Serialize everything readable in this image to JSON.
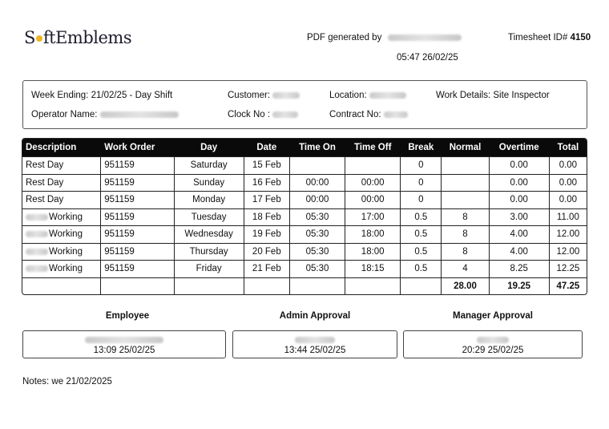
{
  "brand": {
    "logo_left": "S",
    "logo_right": "ftEmblems"
  },
  "header": {
    "generated_label": "PDF generated by",
    "generated_time": "05:47 26/02/25",
    "timesheet_label": "Timesheet ID#",
    "timesheet_id": "4150"
  },
  "info": {
    "week_ending": "Week Ending: 21/02/25 - Day Shift",
    "operator_label": "Operator Name:",
    "customer_label": "Customer:",
    "clock_label": "Clock No :",
    "location_label": "Location:",
    "contract_label": "Contract No:",
    "work_details": "Work Details: Site Inspector"
  },
  "table": {
    "headers": [
      "Description",
      "Work Order",
      "Day",
      "Date",
      "Time On",
      "Time Off",
      "Break",
      "Normal",
      "Overtime",
      "Total"
    ],
    "rows": [
      {
        "desc": "Rest Day",
        "wo": "951159",
        "day": "Saturday",
        "date": "15 Feb",
        "on": "",
        "off": "",
        "brk": "0",
        "normal": "",
        "ot": "0.00",
        "total": "0.00"
      },
      {
        "desc": "Rest Day",
        "wo": "951159",
        "day": "Sunday",
        "date": "16 Feb",
        "on": "00:00",
        "off": "00:00",
        "brk": "0",
        "normal": "",
        "ot": "0.00",
        "total": "0.00"
      },
      {
        "desc": "Rest Day",
        "wo": "951159",
        "day": "Monday",
        "date": "17 Feb",
        "on": "00:00",
        "off": "00:00",
        "brk": "0",
        "normal": "",
        "ot": "0.00",
        "total": "0.00"
      },
      {
        "desc": "Working",
        "wo": "951159",
        "day": "Tuesday",
        "date": "18 Feb",
        "on": "05:30",
        "off": "17:00",
        "brk": "0.5",
        "normal": "8",
        "ot": "3.00",
        "total": "11.00"
      },
      {
        "desc": "Working",
        "wo": "951159",
        "day": "Wednesday",
        "date": "19 Feb",
        "on": "05:30",
        "off": "18:00",
        "brk": "0.5",
        "normal": "8",
        "ot": "4.00",
        "total": "12.00"
      },
      {
        "desc": "Working",
        "wo": "951159",
        "day": "Thursday",
        "date": "20 Feb",
        "on": "05:30",
        "off": "18:00",
        "brk": "0.5",
        "normal": "8",
        "ot": "4.00",
        "total": "12.00"
      },
      {
        "desc": "Working",
        "wo": "951159",
        "day": "Friday",
        "date": "21 Feb",
        "on": "05:30",
        "off": "18:15",
        "brk": "0.5",
        "normal": "4",
        "ot": "8.25",
        "total": "12.25"
      }
    ],
    "totals": {
      "normal": "28.00",
      "ot": "19.25",
      "total": "47.25"
    }
  },
  "approvals": {
    "employee": {
      "label": "Employee",
      "time": "13:09 25/02/25"
    },
    "admin": {
      "label": "Admin Approval",
      "time": "13:44 25/02/25"
    },
    "manager": {
      "label": "Manager Approval",
      "time": "20:29 25/02/25"
    }
  },
  "notes": "Notes: we 21/02/2025"
}
